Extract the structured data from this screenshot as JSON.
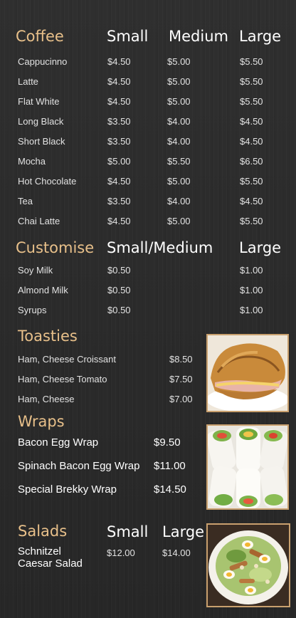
{
  "coffee": {
    "title": "Coffee",
    "col_small": "Small",
    "col_medium": "Medium",
    "col_large": "Large",
    "items": [
      {
        "name": "Cappucinno",
        "small": "$4.50",
        "medium": "$5.00",
        "large": "$5.50"
      },
      {
        "name": "Latte",
        "small": "$4.50",
        "medium": "$5.00",
        "large": "$5.50"
      },
      {
        "name": "Flat White",
        "small": "$4.50",
        "medium": "$5.00",
        "large": "$5.50"
      },
      {
        "name": "Long Black",
        "small": "$3.50",
        "medium": "$4.00",
        "large": "$4.50"
      },
      {
        "name": "Short Black",
        "small": "$3.50",
        "medium": "$4.00",
        "large": "$4.50"
      },
      {
        "name": "Mocha",
        "small": "$5.00",
        "medium": "$5.50",
        "large": "$6.50"
      },
      {
        "name": "Hot Chocolate",
        "small": "$4.50",
        "medium": "$5.00",
        "large": "$5.50"
      },
      {
        "name": "Tea",
        "small": "$3.50",
        "medium": "$4.00",
        "large": "$4.50"
      },
      {
        "name": "Chai Latte",
        "small": "$4.50",
        "medium": "$5.00",
        "large": "$5.50"
      }
    ]
  },
  "customise": {
    "title": "Customise",
    "col_small_medium": "Small/Medium",
    "col_large": "Large",
    "items": [
      {
        "name": "Soy Milk",
        "small_medium": "$0.50",
        "large": "$1.00"
      },
      {
        "name": "Almond Milk",
        "small_medium": "$0.50",
        "large": "$1.00"
      },
      {
        "name": "Syrups",
        "small_medium": "$0.50",
        "large": "$1.00"
      }
    ]
  },
  "toasties": {
    "title": "Toasties",
    "items": [
      {
        "name": "Ham, Cheese Croissant",
        "price": "$8.50"
      },
      {
        "name": "Ham, Cheese Tomato",
        "price": "$7.50"
      },
      {
        "name": "Ham, Cheese",
        "price": "$7.00"
      }
    ]
  },
  "wraps": {
    "title": "Wraps",
    "items": [
      {
        "name": "Bacon Egg Wrap",
        "price": "$9.50"
      },
      {
        "name": "Spinach Bacon Egg Wrap",
        "price": "$11.00"
      },
      {
        "name": "Special Brekky Wrap",
        "price": "$14.50"
      }
    ]
  },
  "salads": {
    "title": "Salads",
    "col_small": "Small",
    "col_large": "Large",
    "item_line1": "Schnitzel",
    "item_line2": "Caesar Salad",
    "small": "$12.00",
    "large": "$14.00"
  },
  "colors": {
    "background": "#2b2b2b",
    "heading": "#e8c08a",
    "photo_border": "#c9a06e"
  }
}
